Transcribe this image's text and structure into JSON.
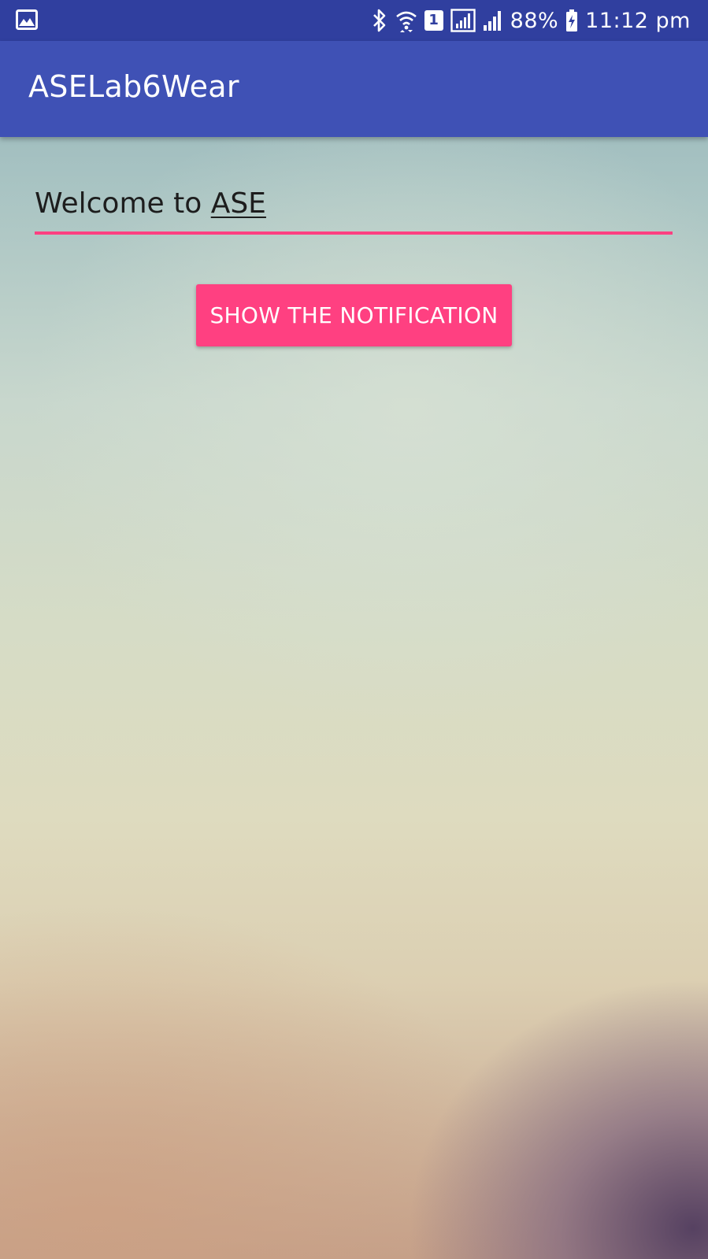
{
  "status_bar": {
    "left_icon": "image-notification-icon",
    "battery_percent": "88%",
    "time": "11:12 pm",
    "sim_label": "1",
    "icons": [
      "bluetooth-icon",
      "wifi-icon",
      "sim-icon",
      "signal-box-icon",
      "signal-icon",
      "battery-charging-icon"
    ]
  },
  "app_bar": {
    "title": "ASELab6Wear",
    "color": "#3f51b5"
  },
  "main": {
    "edit_text": {
      "prefix": "Welcome to ",
      "underlined_word": "ASE",
      "underline_color": "#ff4081"
    },
    "button": {
      "label": "SHOW THE NOTIFICATION",
      "color": "#ff4081"
    }
  },
  "colors": {
    "status_bar": "#303f9f",
    "primary": "#3f51b5",
    "accent": "#ff4081"
  }
}
